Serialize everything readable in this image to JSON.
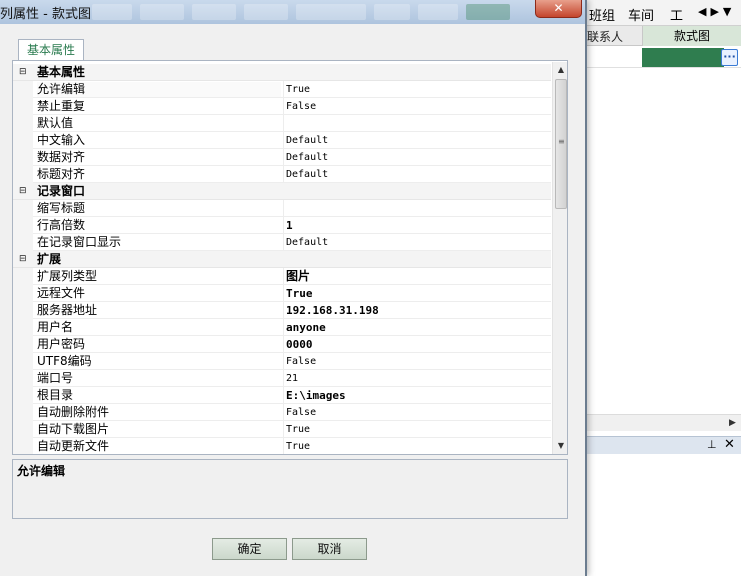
{
  "window": {
    "title": "列属性 - 款式图",
    "close_label": "✕"
  },
  "tabs": [
    {
      "label": "基本属性"
    }
  ],
  "property_grid": {
    "categories": [
      {
        "name": "基本属性",
        "toggle": "⊟",
        "items": [
          {
            "name": "允许编辑",
            "value": "True"
          },
          {
            "name": "禁止重复",
            "value": "False"
          },
          {
            "name": "默认值",
            "value": ""
          },
          {
            "name": "中文输入",
            "value": "Default"
          },
          {
            "name": "数据对齐",
            "value": "Default"
          },
          {
            "name": "标题对齐",
            "value": "Default"
          }
        ]
      },
      {
        "name": "记录窗口",
        "toggle": "⊟",
        "items": [
          {
            "name": "缩写标题",
            "value": ""
          },
          {
            "name": "行高倍数",
            "value": "1"
          },
          {
            "name": "在记录窗口显示",
            "value": "Default"
          }
        ]
      },
      {
        "name": "扩展",
        "toggle": "⊟",
        "items": [
          {
            "name": "扩展列类型",
            "value": "图片"
          },
          {
            "name": "远程文件",
            "value": "True"
          },
          {
            "name": "服务器地址",
            "value": "192.168.31.198"
          },
          {
            "name": "用户名",
            "value": "anyone"
          },
          {
            "name": "用户密码",
            "value": "0000"
          },
          {
            "name": "UTF8编码",
            "value": "False"
          },
          {
            "name": "端口号",
            "value": "21"
          },
          {
            "name": "根目录",
            "value": "E:\\images"
          },
          {
            "name": "自动删除附件",
            "value": "False"
          },
          {
            "name": "自动下载图片",
            "value": "True"
          },
          {
            "name": "自动更新文件",
            "value": "True"
          }
        ]
      }
    ]
  },
  "description": {
    "title": "允许编辑"
  },
  "buttons": {
    "ok": "确定",
    "cancel": "取消"
  },
  "background_app": {
    "menu": [
      "班组",
      "车间",
      "工"
    ],
    "nav_arrows": "◀▶▼",
    "grid_columns": [
      "联系人",
      "款式图"
    ],
    "ellipsis": "···",
    "panel_pin": "⊥",
    "panel_close": "✕",
    "scroll_right": "▶"
  },
  "colors": {
    "accent_green": "#2f7d4f",
    "title_bar": "#aec4de",
    "close_red": "#c4452c"
  }
}
